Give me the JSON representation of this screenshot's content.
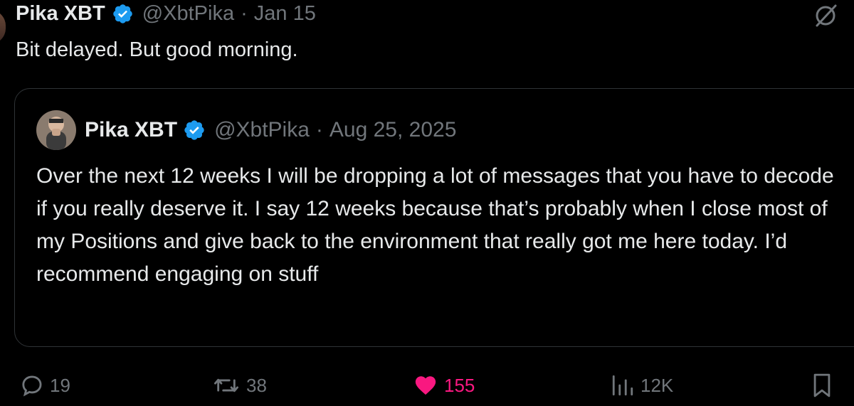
{
  "tweet": {
    "author_name": "Pika XBT",
    "handle": "@XbtPika",
    "separator": "·",
    "date": "Jan 15",
    "text": "Bit delayed. But good morning."
  },
  "quoted_tweet": {
    "author_name": "Pika XBT",
    "handle": "@XbtPika",
    "separator": "·",
    "date": "Aug 25, 2025",
    "text": "Over the next 12 weeks I will be dropping a lot of messages that you have to decode if you really deserve it. I say 12 weeks because that’s probably when I close most of my Positions and give back to the environment that really got me here today. I’d recommend engaging on stuff"
  },
  "actions": {
    "replies": "19",
    "reposts": "38",
    "likes": "155",
    "views": "12K"
  },
  "colors": {
    "background": "#000000",
    "text": "#e7e9ea",
    "muted": "#71767b",
    "verified": "#1d9bf0",
    "like": "#f91880",
    "border": "#2f3336"
  },
  "icons": {
    "verified": "verified-badge-icon",
    "grok": "grok-icon",
    "reply": "reply-icon",
    "repost": "repost-icon",
    "like": "heart-icon",
    "views": "views-icon",
    "bookmark": "bookmark-icon"
  }
}
